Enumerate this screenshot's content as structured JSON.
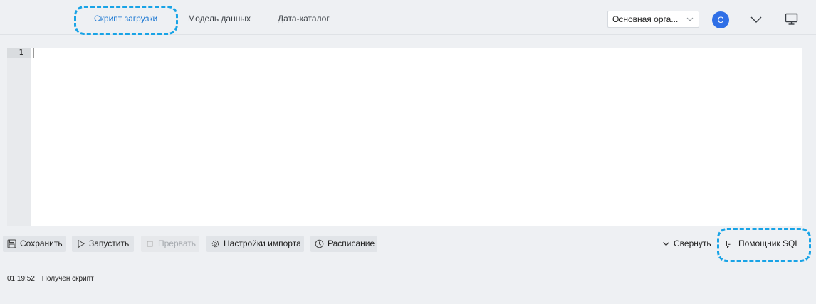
{
  "header": {
    "tabs": [
      {
        "label": "Скрипт загрузки",
        "active": true
      },
      {
        "label": "Модель данных",
        "active": false
      },
      {
        "label": "Дата-каталог",
        "active": false
      }
    ],
    "org_select": {
      "value": "Основная орга..."
    },
    "avatar": {
      "initial": "C",
      "color": "#2f6fe6"
    },
    "icons": [
      "chevron-down-icon",
      "monitor-icon"
    ]
  },
  "editor": {
    "line_numbers": [
      "1"
    ]
  },
  "toolbar": {
    "save_label": "Сохранить",
    "run_label": "Запустить",
    "stop_label": "Прервать",
    "import_settings_label": "Настройки импорта",
    "schedule_label": "Расписание",
    "collapse_label": "Свернуть",
    "assistant_label": "Помощник SQL"
  },
  "log": {
    "entries": [
      {
        "time": "01:19:52",
        "message": "Получен скрипт"
      }
    ]
  },
  "colors": {
    "accent": "#1976d2",
    "highlight_ring": "#18a3e6",
    "background": "#eef0f3"
  }
}
